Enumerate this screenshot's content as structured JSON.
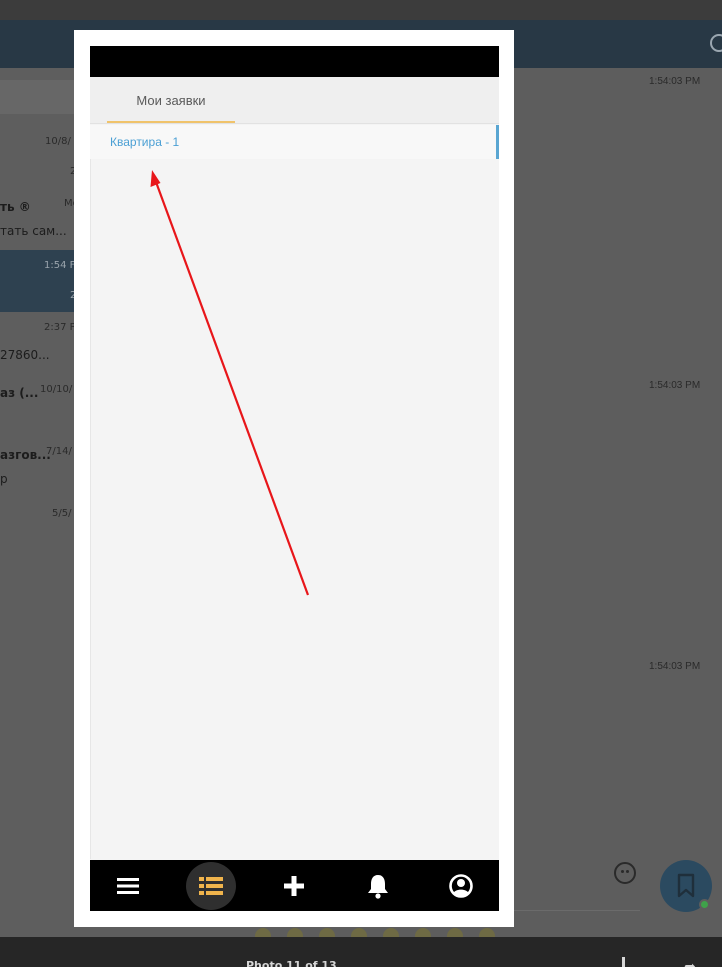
{
  "background_app": {
    "timestamps": [
      "1:54:03 PM",
      "1:54:03 PM",
      "1:54:03 PM"
    ],
    "chat_list": [
      {
        "time": "10/8/"
      },
      {
        "time": "2"
      },
      {
        "time": "Ме"
      },
      {
        "title": "ть ®",
        "preview": "тать сам..."
      },
      {
        "time": "1:54 F"
      },
      {
        "time": "2"
      },
      {
        "time": "2:37 P",
        "preview": "27860..."
      },
      {
        "title": "аз (...",
        "time": "10/10/"
      },
      {
        "title": "азгов...",
        "time": "7/14/",
        "preview": "р"
      },
      {
        "time": "5/5/"
      }
    ],
    "bottom_bar": {
      "counter": "Photo 11 of 13"
    }
  },
  "app": {
    "tabs": [
      {
        "label": "Мои заявки",
        "active": true
      }
    ],
    "requests": [
      {
        "label": "Квартира - 1",
        "selected": true
      }
    ],
    "bottom_nav": [
      {
        "name": "menu",
        "icon": "hamburger-menu-icon"
      },
      {
        "name": "requests",
        "icon": "list-icon",
        "active": true
      },
      {
        "name": "add",
        "icon": "plus-icon"
      },
      {
        "name": "notifications",
        "icon": "bell-icon"
      },
      {
        "name": "profile",
        "icon": "user-profile-icon"
      }
    ]
  },
  "colors": {
    "accent": "#f0b44c",
    "link": "#4a9fd4",
    "annotation_arrow": "#e8161a"
  }
}
